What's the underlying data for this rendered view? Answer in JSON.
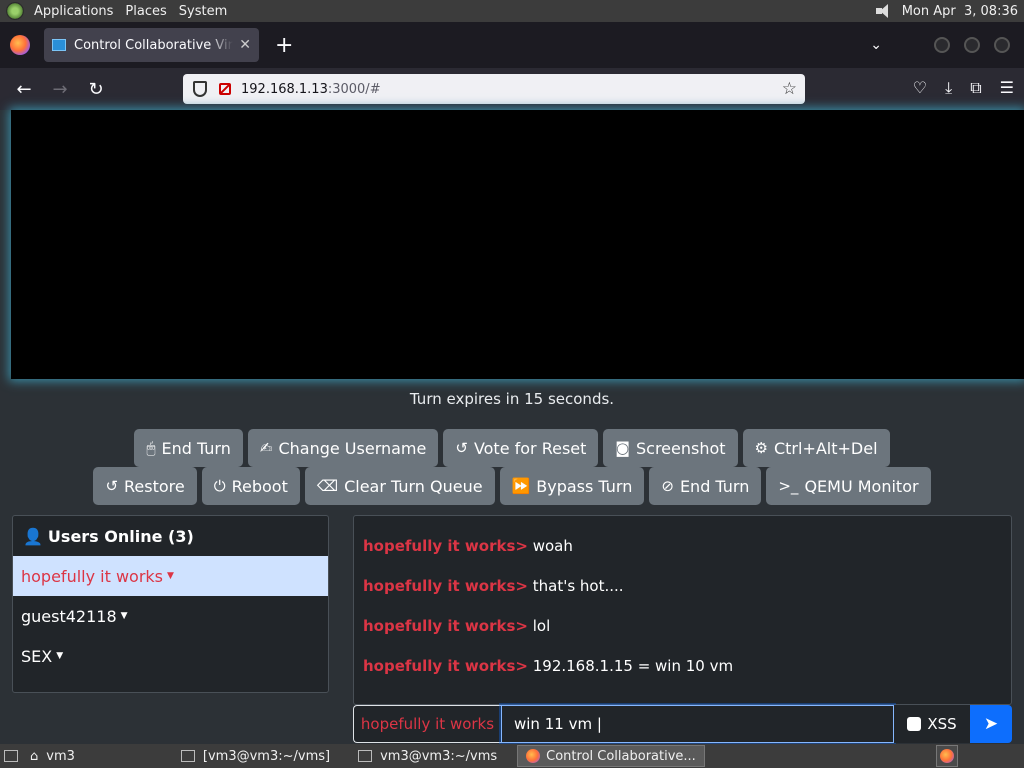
{
  "panel": {
    "menus": [
      "Applications",
      "Places",
      "System"
    ],
    "clock": "Mon Apr  3, 08:36"
  },
  "browser": {
    "tab_title": "Control Collaborative Virtual Machine",
    "url_host": "192.168.1.13",
    "url_rest": ":3000/#"
  },
  "page": {
    "turn_text": "Turn expires in 15 seconds.",
    "buttons_row1": [
      {
        "label": "End Turn",
        "icon": "mouse-icon",
        "glyph": "🖱"
      },
      {
        "label": "Change Username",
        "icon": "signature-icon",
        "glyph": "✍"
      },
      {
        "label": "Vote for Reset",
        "icon": "undo-icon",
        "glyph": "↺"
      },
      {
        "label": "Screenshot",
        "icon": "camera-icon",
        "glyph": "📷"
      },
      {
        "label": "Ctrl+Alt+Del",
        "icon": "gear-icon",
        "glyph": "⚙"
      }
    ],
    "buttons_row2": [
      {
        "label": "Restore",
        "icon": "undo-icon",
        "glyph": "↺"
      },
      {
        "label": "Reboot",
        "icon": "power-icon",
        "glyph": "⏻"
      },
      {
        "label": "Clear Turn Queue",
        "icon": "eraser-icon",
        "glyph": "⌫"
      },
      {
        "label": "Bypass Turn",
        "icon": "fast-forward-icon",
        "glyph": "⏩"
      },
      {
        "label": "End Turn",
        "icon": "ban-icon",
        "glyph": "⊘"
      },
      {
        "label": "QEMU Monitor",
        "icon": "terminal-icon",
        "glyph": ">_"
      }
    ],
    "users": {
      "header": "Users Online (3)",
      "list": [
        {
          "name": "hopefully it works",
          "active": true
        },
        {
          "name": "guest42118",
          "active": false
        },
        {
          "name": "SEX",
          "active": false
        }
      ]
    },
    "chat": {
      "messages": [
        {
          "user": "hopefully it works>",
          "text": "woah"
        },
        {
          "user": "hopefully it works>",
          "text": "that's hot...."
        },
        {
          "user": "hopefully it works>",
          "text": "lol"
        },
        {
          "user": "hopefully it works>",
          "text": "192.168.1.15 = win 10 vm"
        }
      ],
      "username": "hopefully it works",
      "input_value": "win 11 vm |",
      "xss_label": "XSS"
    }
  },
  "taskbar": {
    "items": [
      {
        "label": "vm3"
      },
      {
        "label": "[vm3@vm3:~/vms]"
      },
      {
        "label": "vm3@vm3:~/vms"
      },
      {
        "label": "Control Collaborative..."
      }
    ]
  }
}
